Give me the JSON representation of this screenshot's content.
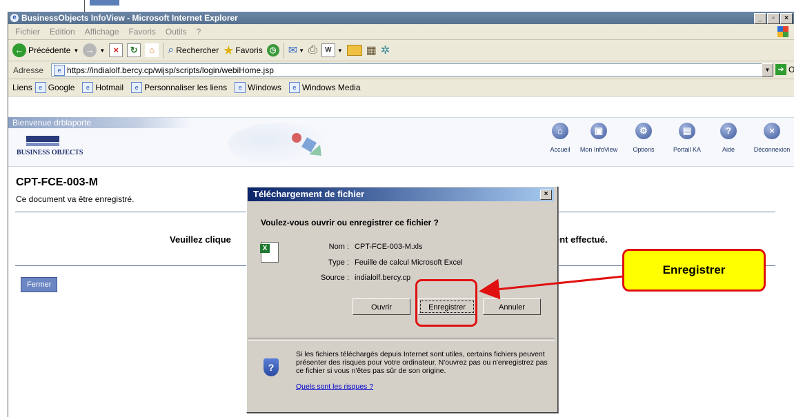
{
  "window": {
    "title": "BusinessObjects InfoView - Microsoft Internet Explorer"
  },
  "menu": [
    "Fichier",
    "Edition",
    "Affichage",
    "Favoris",
    "Outils",
    "?"
  ],
  "toolbar": {
    "back": "Précédente",
    "search": "Rechercher",
    "favorites": "Favoris"
  },
  "address": {
    "label": "Adresse",
    "url": "https://indialolf.bercy.cp/wijsp/scripts/login/webiHome.jsp",
    "go": "OK"
  },
  "links": {
    "label": "Liens",
    "items": [
      "Google",
      "Hotmail",
      "Personnaliser les liens",
      "Windows",
      "Windows Media"
    ]
  },
  "infoview": {
    "welcome": "Bienvenue drblaporte",
    "logo": "BUSINESS OBJECTS",
    "nav": [
      "Accueil",
      "Mon InfoView",
      "Options",
      "Portail KA",
      "Aide",
      "Déconnexion"
    ]
  },
  "page": {
    "title": "CPT-FCE-003-M",
    "subtitle": "Ce document va être enregistré.",
    "prompt_left": "Veuillez clique",
    "prompt_right": "ent effectué.",
    "close_button": "Fermer"
  },
  "dialog": {
    "title": "Téléchargement de fichier",
    "question": "Voulez-vous ouvrir ou enregistrer ce fichier ?",
    "name_label": "Nom :",
    "name_value": "CPT-FCE-003-M.xls",
    "type_label": "Type :",
    "type_value": "Feuille de calcul Microsoft Excel",
    "source_label": "Source :",
    "source_value": "indialolf.bercy.cp",
    "open_button": "Ouvrir",
    "save_button": "Enregistrer",
    "cancel_button": "Annuler",
    "warning": "Si les fichiers téléchargés depuis Internet sont utiles, certains fichiers peuvent présenter des risques pour votre ordinateur. N'ouvrez pas ou n'enregistrez pas ce fichier si vous n'êtes pas sûr de son origine.",
    "risk_link": "Quels sont les risques ?"
  },
  "annotation": {
    "callout": "Enregistrer"
  },
  "colors": {
    "titlebar": "#5f7a9a",
    "highlight": "#e01010",
    "callout_bg": "#ffff00",
    "dialog_title": "#0a246a"
  }
}
